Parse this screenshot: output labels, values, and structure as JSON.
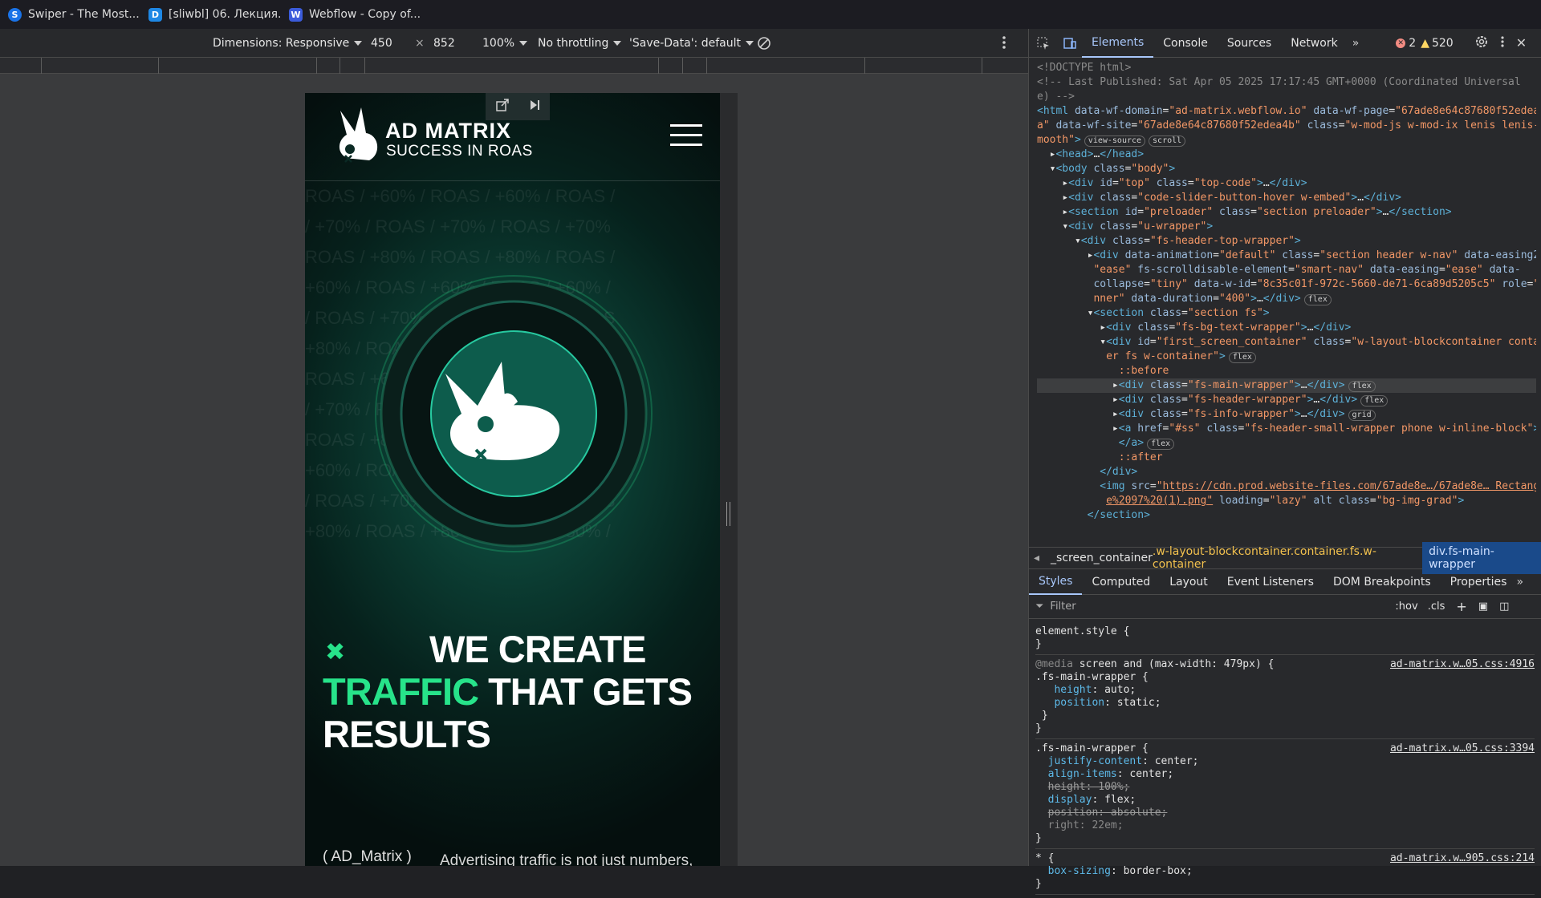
{
  "browser_tabs": [
    {
      "title": "Swiper - The Most...",
      "icon": "swiper-icon",
      "color": "#1a73e8"
    },
    {
      "title": "[sliwbl] 06. Лекция...",
      "icon": "document-icon",
      "color": "#1e88e5"
    },
    {
      "title": "Webflow - Copy of...",
      "icon": "webflow-icon",
      "color": "#3b5bdb"
    }
  ],
  "device_toolbar": {
    "dimensions_label": "Dimensions: Responsive",
    "width": "450",
    "times": "×",
    "height": "852",
    "zoom": "100%",
    "throttling": "No throttling",
    "save_data": "'Save-Data': default"
  },
  "site": {
    "brand_title": "AD MATRIX",
    "brand_subtitle": "SUCCESS IN ROAS",
    "bg_lines": [
      "ROAS / +60% / ROAS / +60% / ROAS /",
      "/ +70% / ROAS / +70% / ROAS / +70%",
      "ROAS / +80% / ROAS / +80% / ROAS /",
      "+60% / ROAS / +60% / ROAS / +60% /",
      "/ ROAS / +70% / ROAS / +70% / ROAS",
      "+80% / ROAS / +80% / ROAS / +80% /",
      "ROAS / +60% / ROAS / +60% / ROAS /",
      "/ +70% / ROAS / +70% / ROAS / +70%",
      "ROAS / +80% / ROAS / +80% / ROAS /",
      "+60% / ROAS / +60% / ROAS / +60% /",
      "/ ROAS / +70% / ROAS / +70% / ROAS",
      "+80% / ROAS / +80% / ROAS / +80% /"
    ],
    "headline_1": "WE CREATE",
    "headline_highlight": "TRAFFIC",
    "headline_2": " THAT GETS",
    "headline_3": "RESULTS",
    "tagline": "( AD_Matrix )",
    "description": "Advertising traffic is not just numbers, but an investment that should pay off quickly",
    "accent_color": "#27e38a"
  },
  "devtools": {
    "tabs": [
      "Elements",
      "Console",
      "Sources",
      "Network"
    ],
    "active_tab": "Elements",
    "errors": "2",
    "warnings": "520",
    "breadcrumb_1": "_screen_container",
    "breadcrumb_2": ".w-layout-blockcontainer.container.fs.w-container",
    "breadcrumb_selected": "div.fs-main-wrapper",
    "style_tabs": [
      "Styles",
      "Computed",
      "Layout",
      "Event Listeners",
      "DOM Breakpoints",
      "Properties"
    ],
    "filter_placeholder": "Filter",
    "hov": ":hov",
    "cls": ".cls"
  }
}
